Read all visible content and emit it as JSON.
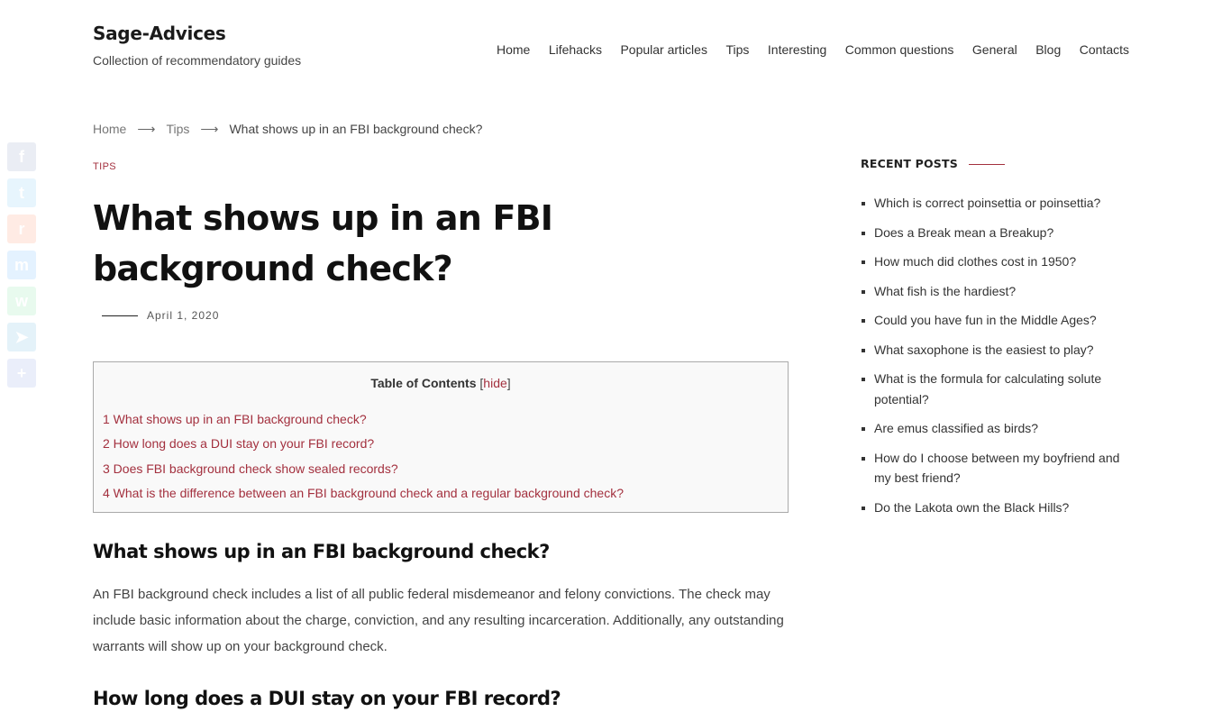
{
  "site": {
    "title": "Sage-Advices",
    "tagline": "Collection of recommendatory guides"
  },
  "nav": {
    "items": [
      {
        "label": "Home"
      },
      {
        "label": "Lifehacks"
      },
      {
        "label": "Popular articles"
      },
      {
        "label": "Tips"
      },
      {
        "label": "Interesting"
      },
      {
        "label": "Common questions"
      },
      {
        "label": "General"
      },
      {
        "label": "Blog"
      },
      {
        "label": "Contacts"
      }
    ]
  },
  "social": [
    {
      "name": "facebook",
      "icon": "f",
      "color": "#3b5998"
    },
    {
      "name": "twitter",
      "icon": "t",
      "color": "#1da1f2"
    },
    {
      "name": "reddit",
      "icon": "r",
      "color": "#ff4500"
    },
    {
      "name": "messenger",
      "icon": "m",
      "color": "#0084ff"
    },
    {
      "name": "whatsapp",
      "icon": "w",
      "color": "#25d366"
    },
    {
      "name": "telegram",
      "icon": "➤",
      "color": "#0088cc"
    },
    {
      "name": "share",
      "icon": "+",
      "color": "#3b5ed8"
    }
  ],
  "breadcrumb": {
    "home": "Home",
    "separator": "⟶",
    "category": "Tips",
    "current": "What shows up in an FBI background check?"
  },
  "article": {
    "category": "TIPS",
    "title": "What shows up in an FBI background check?",
    "date": "April 1, 2020",
    "toc": {
      "title": "Table of Contents",
      "open_bracket": "[",
      "toggle": "hide",
      "close_bracket": "]",
      "items": [
        {
          "label": "1 What shows up in an FBI background check?"
        },
        {
          "label": "2 How long does a DUI stay on your FBI record?"
        },
        {
          "label": "3 Does FBI background check show sealed records?"
        },
        {
          "label": "4 What is the difference between an FBI background check and a regular background check?"
        }
      ]
    },
    "sections": [
      {
        "heading": "What shows up in an FBI background check?",
        "body": "An FBI background check includes a list of all public federal misdemeanor and felony convictions. The check may include basic information about the charge, conviction, and any resulting incarceration. Additionally, any outstanding warrants will show up on your background check."
      },
      {
        "heading": "How long does a DUI stay on your FBI record?"
      }
    ]
  },
  "sidebar": {
    "widget_title": "RECENT POSTS",
    "recent_posts": [
      {
        "label": "Which is correct poinsettia or poinsettia?"
      },
      {
        "label": "Does a Break mean a Breakup?"
      },
      {
        "label": "How much did clothes cost in 1950?"
      },
      {
        "label": "What fish is the hardiest?"
      },
      {
        "label": "Could you have fun in the Middle Ages?"
      },
      {
        "label": "What saxophone is the easiest to play?"
      },
      {
        "label": "What is the formula for calculating solute potential?"
      },
      {
        "label": "Are emus classified as birds?"
      },
      {
        "label": "How do I choose between my boyfriend and my best friend?"
      },
      {
        "label": "Do the Lakota own the Black Hills?"
      }
    ]
  },
  "colors": {
    "accent": "#a3303e",
    "text": "#333333",
    "heading": "#111111"
  }
}
